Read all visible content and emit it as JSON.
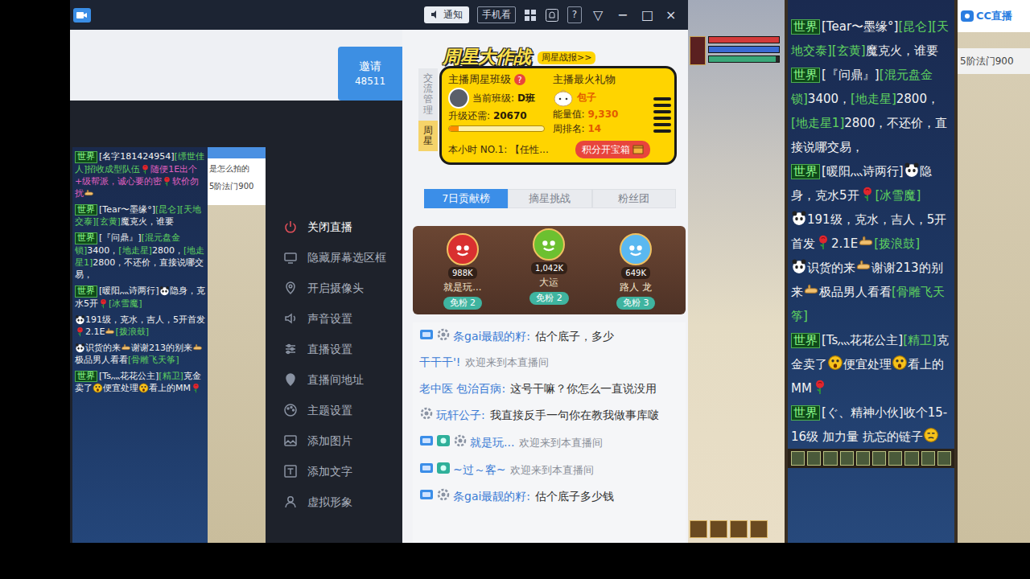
{
  "app": {
    "titlebar": {
      "notify": "通知",
      "mobile": "手机看",
      "help": "?",
      "collapse": "▽",
      "minimize": "−",
      "maximize": "□",
      "close": "×"
    },
    "invite": {
      "label": "邀请",
      "count": "48511"
    },
    "menu": [
      {
        "label": "关闭直播",
        "highlighted": true
      },
      {
        "label": "隐藏屏幕选区框",
        "highlighted": false
      },
      {
        "label": "开启摄像头",
        "highlighted": false
      },
      {
        "label": "声音设置",
        "highlighted": false
      },
      {
        "label": "直播设置",
        "highlighted": false
      },
      {
        "label": "直播间地址",
        "highlighted": false
      },
      {
        "label": "主题设置",
        "highlighted": false
      },
      {
        "label": "添加图片",
        "highlighted": false
      },
      {
        "label": "添加文字",
        "highlighted": false
      },
      {
        "label": "虚拟形象",
        "highlighted": false
      }
    ],
    "preview": {
      "popup": [
        "是怎么拍的",
        "5阶法门900"
      ],
      "messages": [
        {
          "segments": [
            {
              "kind": "tag",
              "text": "世界"
            },
            {
              "kind": "text",
              "text": "[名字181424954]",
              "color": "#f2f2f2"
            },
            {
              "kind": "text",
              "text": "[缥世佳人]招收成型队伍",
              "color": "#5fd35f"
            },
            {
              "kind": "rose"
            },
            {
              "kind": "text",
              "text": "随便1E出个+级帮派，诚心要的密",
              "color": "#e060c0"
            },
            {
              "kind": "rose"
            },
            {
              "kind": "text",
              "text": "软价勿扰",
              "color": "#e060c0"
            },
            {
              "kind": "hand"
            }
          ]
        },
        {
          "segments": [
            {
              "kind": "tag",
              "text": "世界"
            },
            {
              "kind": "text",
              "text": "[Tear〜墨缘°]",
              "color": "#f2f2f2"
            },
            {
              "kind": "text",
              "text": "[昆仑][天地交泰][玄黄]",
              "color": "#5fd35f"
            },
            {
              "kind": "text",
              "text": "魔克火，谁要",
              "color": "#f2f2f2"
            }
          ]
        },
        {
          "segments": [
            {
              "kind": "tag",
              "text": "世界"
            },
            {
              "kind": "text",
              "text": "[『问鼎』]",
              "color": "#f2f2f2"
            },
            {
              "kind": "text",
              "text": "[混元盘金锁]",
              "color": "#5fd35f"
            },
            {
              "kind": "text",
              "text": "3400，",
              "color": "#f2f2f2"
            },
            {
              "kind": "text",
              "text": "[地走星]",
              "color": "#5fd35f"
            },
            {
              "kind": "text",
              "text": "2800，",
              "color": "#f2f2f2"
            },
            {
              "kind": "text",
              "text": "[地走星1]",
              "color": "#5fd35f"
            },
            {
              "kind": "text",
              "text": "2800，不还价，直接说哪交易，",
              "color": "#f2f2f2"
            }
          ]
        },
        {
          "segments": [
            {
              "kind": "tag",
              "text": "世界"
            },
            {
              "kind": "text",
              "text": "[暖阳灬诗两行]",
              "color": "#f2f2f2"
            },
            {
              "kind": "panda"
            },
            {
              "kind": "text",
              "text": "隐身，克水5开",
              "color": "#f2f2f2"
            },
            {
              "kind": "rose"
            },
            {
              "kind": "text",
              "text": "[冰雪魔]",
              "color": "#5fd35f"
            }
          ]
        },
        {
          "segments": [
            {
              "kind": "panda"
            },
            {
              "kind": "text",
              "text": "191级，克水，吉人，5开首发",
              "color": "#f2f2f2"
            },
            {
              "kind": "rose"
            },
            {
              "kind": "text",
              "text": "2.1E",
              "color": "#f2f2f2"
            },
            {
              "kind": "hand"
            },
            {
              "kind": "text",
              "text": "[拨浪鼓]",
              "color": "#5fd35f"
            }
          ]
        },
        {
          "segments": [
            {
              "kind": "panda"
            },
            {
              "kind": "text",
              "text": "识货的来",
              "color": "#f2f2f2"
            },
            {
              "kind": "hand"
            },
            {
              "kind": "text",
              "text": "谢谢213的别来",
              "color": "#f2f2f2"
            },
            {
              "kind": "hand"
            },
            {
              "kind": "text",
              "text": "极品男人看看",
              "color": "#f2f2f2"
            },
            {
              "kind": "text",
              "text": "[骨雕飞天筝]",
              "color": "#5fd35f"
            }
          ]
        },
        {
          "segments": [
            {
              "kind": "tag",
              "text": "世界"
            },
            {
              "kind": "text",
              "text": "[Ts灬花花公主]",
              "color": "#f2f2f2"
            },
            {
              "kind": "text",
              "text": "[精卫]",
              "color": "#5fd35f"
            },
            {
              "kind": "text",
              "text": "克金卖了",
              "color": "#f2f2f2"
            },
            {
              "kind": "shock"
            },
            {
              "kind": "text",
              "text": "便宜处理",
              "color": "#f2f2f2"
            },
            {
              "kind": "shock"
            },
            {
              "kind": "text",
              "text": "看上的MM",
              "color": "#f2f2f2"
            },
            {
              "kind": "rose"
            }
          ]
        }
      ]
    }
  },
  "side_tabs": [
    {
      "label": "交流管理",
      "selected": false
    },
    {
      "label": "周星",
      "selected": true
    }
  ],
  "week_star": {
    "title": "周星大作战",
    "report": "周星战报>>",
    "class_title": "主播周星班级",
    "class_help": "?",
    "class_label": "当前班级:",
    "class_value": "D班",
    "upgrade_label": "升级还需:",
    "upgrade_value": "20670",
    "upgrade_level": 0.1,
    "gift_title": "主播最火礼物",
    "gift_name": "包子",
    "energy_label": "能量值:",
    "energy_value": "9,330",
    "rank_label": "周排名:",
    "rank_value": "14",
    "hour_label": "本小时 NO.1:",
    "hour_value": "【任性...",
    "chest_button": "积分开宝箱"
  },
  "rank_tabs": [
    {
      "label": "7日贡献榜",
      "selected": true
    },
    {
      "label": "摘星挑战",
      "selected": false
    },
    {
      "label": "粉丝团",
      "selected": false
    }
  ],
  "podium": [
    {
      "score": "988K",
      "name": "就是玩...",
      "badge": "免粉 2",
      "color": "#d93030"
    },
    {
      "score": "1,042K",
      "name": "大运",
      "badge": "免粉 2",
      "color": "#6cc030"
    },
    {
      "score": "649K",
      "name": "路人 龙",
      "badge": "免粉 3",
      "color": "#5ab8f0"
    }
  ],
  "stream_chat": [
    {
      "kind": "chat",
      "badges": [
        {
          "kind": "level"
        },
        {
          "kind": "gear"
        }
      ],
      "name": "条gai最靓的籽:",
      "text": "估个底子，多少"
    },
    {
      "kind": "welcome",
      "badges": [],
      "name": "干干干'!",
      "text": "欢迎来到本直播间"
    },
    {
      "kind": "chat",
      "badges": [],
      "name": "老中医 包治百病:",
      "text": "这号干嘛？你怎么一直说没用"
    },
    {
      "kind": "chat",
      "badges": [
        {
          "kind": "gear"
        }
      ],
      "name": "玩轩公子:",
      "text": "我直接反手一句你在教我做事库啵"
    },
    {
      "kind": "welcome",
      "badges": [
        {
          "kind": "level"
        },
        {
          "kind": "fan"
        },
        {
          "kind": "gear"
        }
      ],
      "name": "就是玩...",
      "text": "欢迎来到本直播间"
    },
    {
      "kind": "welcome",
      "badges": [
        {
          "kind": "level"
        },
        {
          "kind": "fan"
        }
      ],
      "name": "~过～客~",
      "text": "欢迎来到本直播间"
    },
    {
      "kind": "chat",
      "badges": [
        {
          "kind": "level"
        },
        {
          "kind": "gear"
        }
      ],
      "name": "条gai最靓的籽:",
      "text": "估个底子多少钱"
    }
  ],
  "game": {
    "hud": [
      {
        "level": 1,
        "color": "#d33a3a"
      },
      {
        "level": 1,
        "color": "#3a6ad3"
      },
      {
        "level": 0.95,
        "color": "#3aa87a"
      }
    ],
    "chat": [
      {
        "segments": [
          {
            "kind": "tag",
            "text": "世界"
          },
          {
            "kind": "text",
            "text": "[Tear〜墨缘°]",
            "color": "#f2f2f2"
          },
          {
            "kind": "text",
            "text": "[昆仑][天地交泰][玄黄]",
            "color": "#5fd35f"
          },
          {
            "kind": "text",
            "text": "魔克火，谁要",
            "color": "#f2f2f2"
          }
        ]
      },
      {
        "segments": [
          {
            "kind": "tag",
            "text": "世界"
          },
          {
            "kind": "text",
            "text": "[『问鼎』]",
            "color": "#f2f2f2"
          },
          {
            "kind": "text",
            "text": "[混元盘金锁]",
            "color": "#5fd35f"
          },
          {
            "kind": "text",
            "text": "3400，",
            "color": "#f2f2f2"
          },
          {
            "kind": "text",
            "text": "[地走星]",
            "color": "#5fd35f"
          },
          {
            "kind": "text",
            "text": "2800，",
            "color": "#f2f2f2"
          },
          {
            "kind": "text",
            "text": "[地走星1]",
            "color": "#5fd35f"
          },
          {
            "kind": "text",
            "text": "2800，不还价，直接说哪交易，",
            "color": "#f2f2f2"
          }
        ]
      },
      {
        "segments": [
          {
            "kind": "tag",
            "text": "世界"
          },
          {
            "kind": "text",
            "text": "[暖阳灬诗两行]",
            "color": "#f2f2f2"
          },
          {
            "kind": "panda"
          },
          {
            "kind": "text",
            "text": "隐身，克水5开",
            "color": "#f2f2f2"
          },
          {
            "kind": "rose"
          },
          {
            "kind": "text",
            "text": "[冰雪魔]",
            "color": "#5fd35f"
          }
        ]
      },
      {
        "segments": [
          {
            "kind": "panda"
          },
          {
            "kind": "text",
            "text": "191级，克水，吉人，5开首发",
            "color": "#f2f2f2"
          },
          {
            "kind": "rose"
          },
          {
            "kind": "text",
            "text": "2.1E",
            "color": "#f2f2f2"
          },
          {
            "kind": "hand"
          },
          {
            "kind": "text",
            "text": "[拨浪鼓]",
            "color": "#5fd35f"
          }
        ]
      },
      {
        "segments": [
          {
            "kind": "panda"
          },
          {
            "kind": "text",
            "text": "识货的来",
            "color": "#f2f2f2"
          },
          {
            "kind": "hand"
          },
          {
            "kind": "text",
            "text": "谢谢213的别来",
            "color": "#f2f2f2"
          },
          {
            "kind": "hand"
          },
          {
            "kind": "text",
            "text": "极品男人看看",
            "color": "#f2f2f2"
          },
          {
            "kind": "text",
            "text": "[骨雕飞天筝]",
            "color": "#5fd35f"
          }
        ]
      },
      {
        "segments": [
          {
            "kind": "tag",
            "text": "世界"
          },
          {
            "kind": "text",
            "text": "[Ts灬花花公主]",
            "color": "#f2f2f2"
          },
          {
            "kind": "text",
            "text": "[精卫]",
            "color": "#5fd35f"
          },
          {
            "kind": "text",
            "text": "克金卖了",
            "color": "#f2f2f2"
          },
          {
            "kind": "shock"
          },
          {
            "kind": "text",
            "text": "便宜处理",
            "color": "#f2f2f2"
          },
          {
            "kind": "shock"
          },
          {
            "kind": "text",
            "text": "看上的MM",
            "color": "#f2f2f2"
          },
          {
            "kind": "rose"
          }
        ]
      },
      {
        "segments": [
          {
            "kind": "tag",
            "text": "世界"
          },
          {
            "kind": "text",
            "text": "[ぐ、精神小伙]",
            "color": "#f2f2f2"
          },
          {
            "kind": "text",
            "text": "收个15-16级 加力量 抗忘的链子",
            "color": "#f2f2f2"
          },
          {
            "kind": "meh"
          }
        ]
      }
    ],
    "popup": {
      "logo": "CC直播",
      "text": "5阶法门900"
    }
  }
}
